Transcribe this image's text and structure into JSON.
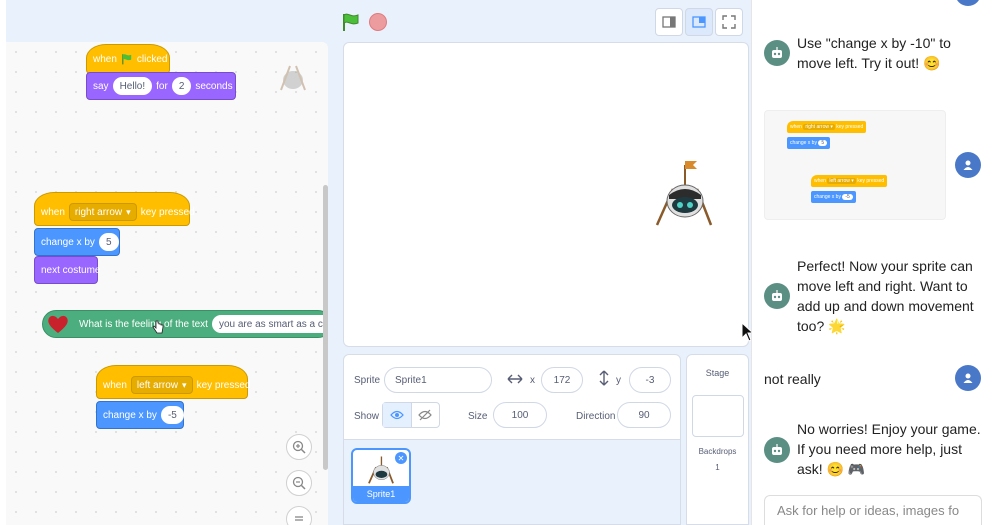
{
  "topbar": {
    "green_flag_icon": "green-flag",
    "stop_icon": "stop-sign",
    "layout_buttons": [
      "small-stage-icon",
      "normal-stage-icon",
      "fullscreen-icon"
    ]
  },
  "code": {
    "script1": {
      "hat_when": "when",
      "hat_clicked": "clicked",
      "say": "say",
      "say_text": "Hello!",
      "say_for": "for",
      "say_secs": "2",
      "say_seconds": "seconds"
    },
    "script2": {
      "when": "when",
      "key": "right arrow",
      "key_pressed": "key pressed",
      "change_x": "change x by",
      "dx": "5",
      "next_costume": "next costume"
    },
    "script3": {
      "question": "What is the feeling of the text",
      "text": "you are as smart as a can"
    },
    "script4": {
      "when": "when",
      "key": "left arrow",
      "key_pressed": "key pressed",
      "change_x": "change x by",
      "dx": "-5"
    }
  },
  "sprite_info": {
    "sprite_label": "Sprite",
    "sprite_name": "Sprite1",
    "x_label": "x",
    "x": "172",
    "y_label": "y",
    "y": "-3",
    "show_label": "Show",
    "size_label": "Size",
    "size": "100",
    "direction_label": "Direction",
    "direction": "90",
    "tile_name": "Sprite1"
  },
  "stage_panel": {
    "title": "Stage",
    "backdrops_label": "Backdrops",
    "backdrops_count": "1"
  },
  "chat": {
    "msg1": "Use \"change x by -10\" to move left. Try it out! 😊",
    "img": {
      "when1": "when",
      "key1": "right arrow ▾",
      "pressed1": "key pressed",
      "change1": "change x by",
      "v1": "5",
      "when2": "when",
      "key2": "left arrow ▾",
      "pressed2": "key pressed",
      "change2": "change x by",
      "v2": "-5"
    },
    "msg2": "Perfect! Now your sprite can move left and right. Want to add up and down movement too? 🌟",
    "user_msg": "not really",
    "msg3": "No worries! Enjoy your game. If you need more help, just ask! 😊 🎮",
    "input_placeholder": "Ask for help or ideas, images fo"
  },
  "colors": {
    "events": "#ffbf00",
    "looks": "#9966ff",
    "motion": "#4c97ff",
    "extension": "#4cae7e",
    "bot_avatar": "#5b8f83",
    "user_avatar": "#4a78c8"
  }
}
